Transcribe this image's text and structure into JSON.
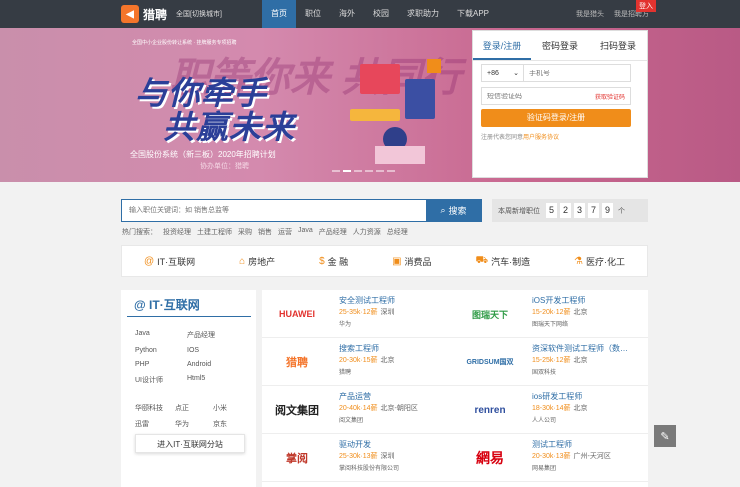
{
  "header": {
    "logo_text": "猎聘",
    "city": "全国[切换城市]",
    "nav": [
      "首页",
      "职位",
      "海外",
      "校园",
      "求职助力",
      "下载APP"
    ],
    "links": [
      "我是猎头",
      "我是招聘方"
    ],
    "badge": "登入"
  },
  "banner": {
    "small_text": "全国中小企业股份转让系统 · 挂牌服务专项招聘",
    "bg_text": "职等你来 共同行",
    "title_line1": "与你牵手",
    "title_line2": "共赢未来",
    "subtitle": "全国股份系统（新三板）2020年招聘计划",
    "organizer": "协办单位：猎聘"
  },
  "login": {
    "tabs": [
      "登录/注册",
      "密码登录",
      "扫码登录"
    ],
    "country_code": "+86",
    "phone_placeholder": "手机号",
    "code_placeholder": "短信验证码",
    "get_code": "获取验证码",
    "submit": "验证码登录/注册",
    "agree_prefix": "注册代表您同意",
    "agree_link": "用户服务协议"
  },
  "search": {
    "placeholder": "输入职位关键词：如 销售总监等",
    "button": "搜索",
    "hot_label": "热门搜索：",
    "hot": [
      "投资经理",
      "土建工程师",
      "采购",
      "销售",
      "运营",
      "Java",
      "产品经理",
      "人力资源",
      "总经理"
    ]
  },
  "new_jobs": {
    "label": "本周新增职位",
    "digits": [
      "5",
      "2",
      "3",
      "7",
      "9"
    ],
    "unit": "个"
  },
  "categories": [
    {
      "icon": "@",
      "label": "IT·互联网"
    },
    {
      "icon": "⌂",
      "label": "房地产"
    },
    {
      "icon": "$",
      "label": "金 融"
    },
    {
      "icon": "▣",
      "label": "消费品"
    },
    {
      "icon": "⛟",
      "label": "汽车·制造"
    },
    {
      "icon": "⚗",
      "label": "医疗·化工"
    }
  ],
  "sidebar": {
    "title": "@ IT·互联网",
    "skills": [
      "Java",
      "产品经理",
      "Python",
      "IOS",
      "PHP",
      "Android",
      "UI设计师",
      "Html5"
    ],
    "companies": [
      "华颐科技",
      "点正",
      "小米",
      "迅雷",
      "华为",
      "京东"
    ],
    "enter": "进入IT·互联网分站"
  },
  "jobs": [
    {
      "logo": "HUAWEI",
      "logo_color": "#e2332f",
      "title": "安全测试工程师",
      "salary": "25-35k·12薪",
      "city": "深圳",
      "company": "华为"
    },
    {
      "logo": "图瑞天下",
      "logo_color": "#2e9a45",
      "title": "iOS开发工程师",
      "salary": "15-20k·12薪",
      "city": "北京",
      "company": "图瑞天下网络"
    },
    {
      "logo": "猎聘",
      "logo_color": "#f4752b",
      "title": "搜索工程师",
      "salary": "20-30k·15薪",
      "city": "北京",
      "company": "猎聘"
    },
    {
      "logo": "GRIDSUM国双",
      "logo_color": "#2f6ea6",
      "title": "资深软件测试工程师（数…",
      "salary": "15-25k·12薪",
      "city": "北京",
      "company": "国双科技"
    },
    {
      "logo": "阅文集团",
      "logo_color": "#222222",
      "title": "产品运营",
      "salary": "20-40k·14薪",
      "city": "北京-朝阳区",
      "company": "阅文集团"
    },
    {
      "logo": "renren",
      "logo_color": "#2f4f9e",
      "title": "ios研发工程师",
      "salary": "18-30k·14薪",
      "city": "北京",
      "company": "人人公司"
    },
    {
      "logo": "掌阅",
      "logo_color": "#c0392b",
      "title": "驱动开发",
      "salary": "25-30k·13薪",
      "city": "深圳",
      "company": "掌阅科技股份有限公司"
    },
    {
      "logo": "網易",
      "logo_color": "#d7000f",
      "title": "测试工程师",
      "salary": "20-30k·13薪",
      "city": "广州-天河区",
      "company": "网易集团"
    }
  ]
}
